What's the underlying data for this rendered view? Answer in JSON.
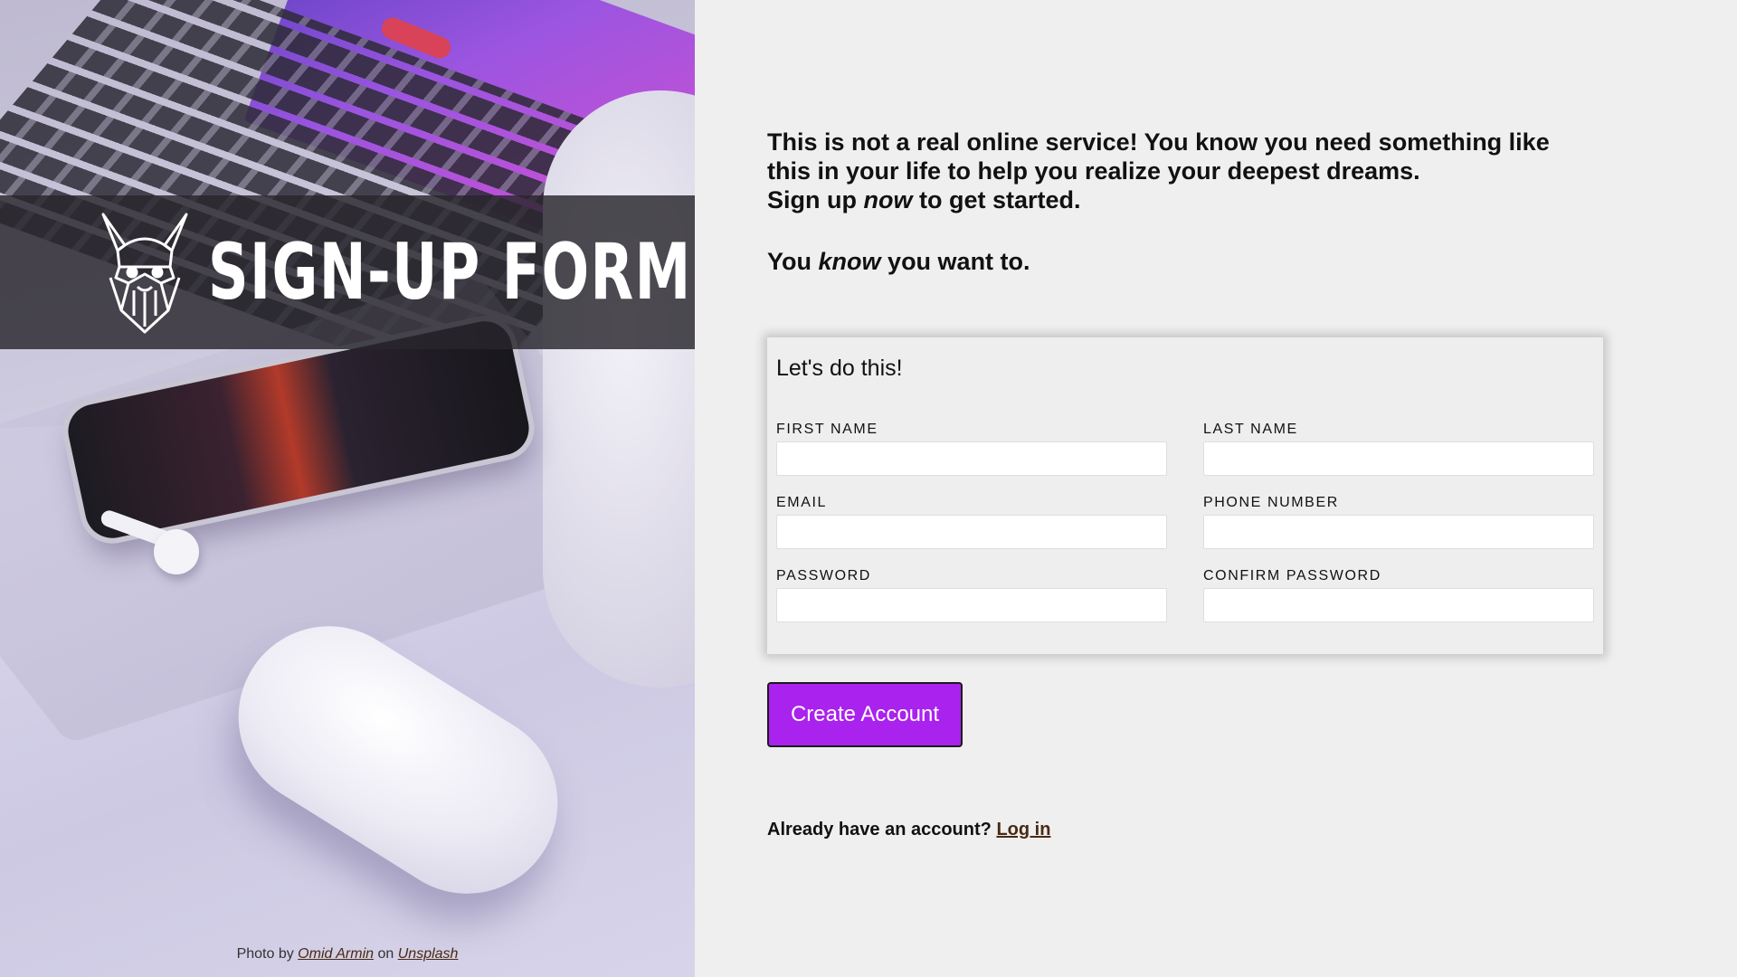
{
  "banner": {
    "title": "SIGN-UP FORM"
  },
  "photo_credit": {
    "prefix": "Photo by",
    "author": "Omid Armin",
    "on": "on",
    "source": "Unsplash"
  },
  "intro": {
    "line1": "This is not a real online service! You know you need something like this in your life to help you realize your deepest dreams.",
    "line2_before": "Sign up",
    "line2_em": "now",
    "line2_after": "to get started.",
    "line3_before": "You",
    "line3_em": "know",
    "line3_after": "you want to."
  },
  "form": {
    "title": "Let's do this!",
    "fields": {
      "first_name": {
        "label": "FIRST NAME",
        "value": ""
      },
      "last_name": {
        "label": "LAST NAME",
        "value": ""
      },
      "email": {
        "label": "EMAIL",
        "value": ""
      },
      "phone": {
        "label": "PHONE NUMBER",
        "value": ""
      },
      "password": {
        "label": "PASSWORD",
        "value": ""
      },
      "confirm_password": {
        "label": "CONFIRM PASSWORD",
        "value": ""
      }
    }
  },
  "actions": {
    "create_label": "Create Account",
    "login_prompt": "Already have an account?",
    "login_link": "Log in"
  },
  "colors": {
    "accent": "#aa22ee",
    "link": "#4a2a12",
    "background": "#efefef"
  },
  "icons": {
    "logo": "viking-helmet-icon"
  }
}
